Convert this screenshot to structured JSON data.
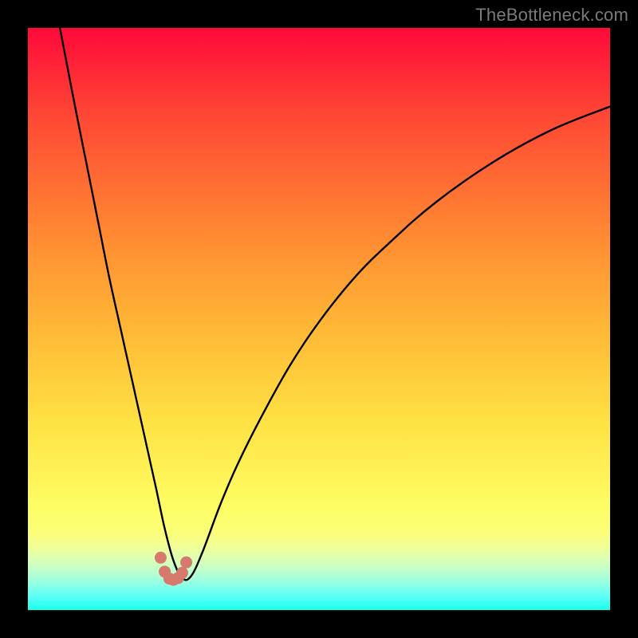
{
  "watermark": "TheBottleneck.com",
  "colors": {
    "background": "#000000",
    "curve": "#000000",
    "marker": "#d77a6d",
    "watermark": "#7b7b7b"
  },
  "chart_data": {
    "type": "line",
    "title": "",
    "xlabel": "",
    "ylabel": "",
    "xlim": [
      0,
      100
    ],
    "ylim": [
      0,
      100
    ],
    "series": [
      {
        "name": "bottleneck-curve",
        "x": [
          5.5,
          8,
          10,
          12,
          14,
          16,
          18,
          20,
          22,
          23.5,
          25,
          26.5,
          28,
          30,
          33,
          36,
          40,
          45,
          50,
          56,
          62,
          70,
          80,
          90,
          100
        ],
        "y": [
          100,
          87,
          77,
          67,
          57,
          48,
          39,
          30,
          21,
          14,
          8.5,
          5.5,
          5.8,
          10,
          18,
          25,
          33,
          42,
          49.5,
          57,
          63,
          70,
          77,
          82.5,
          86.5
        ]
      }
    ],
    "markers": {
      "name": "highlight-dip",
      "x": [
        22.8,
        23.5,
        24.3,
        25.0,
        25.8,
        26.5,
        27.2
      ],
      "y": [
        9.0,
        6.6,
        5.4,
        5.2,
        5.5,
        6.4,
        8.2
      ]
    },
    "background_gradient": {
      "orientation": "vertical",
      "stops": [
        {
          "pos": 0.0,
          "color": "#ff0a3a"
        },
        {
          "pos": 0.27,
          "color": "#ff6e33"
        },
        {
          "pos": 0.54,
          "color": "#ffbe37"
        },
        {
          "pos": 0.82,
          "color": "#fdfd63"
        },
        {
          "pos": 0.93,
          "color": "#c3ffc9"
        },
        {
          "pos": 1.0,
          "color": "#18ffde"
        }
      ]
    }
  }
}
